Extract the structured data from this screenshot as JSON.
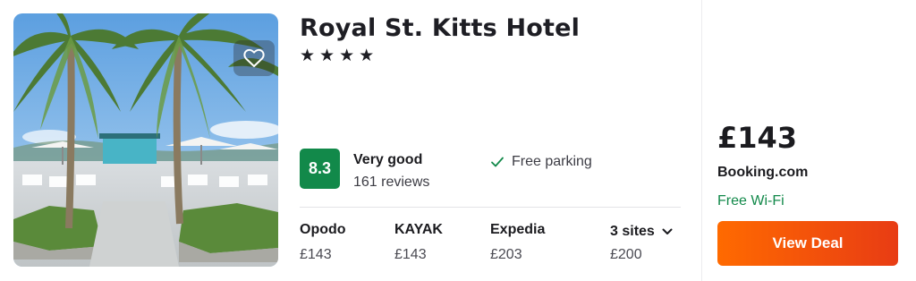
{
  "hotel": {
    "name": "Royal St. Kitts Hotel",
    "stars": [
      "★",
      "★",
      "★",
      "★"
    ],
    "rating": {
      "score": "8.3",
      "label": "Very good",
      "reviews": "161 reviews",
      "badge_color": "#12894a"
    },
    "amenity": {
      "icon": "check-icon",
      "text": "Free parking"
    }
  },
  "providers": [
    {
      "name": "Opodo",
      "price": "£143"
    },
    {
      "name": "KAYAK",
      "price": "£143"
    },
    {
      "name": "Expedia",
      "price": "£203"
    }
  ],
  "more_sites": {
    "label": "3 sites",
    "price": "£200",
    "icon": "chevron-down-icon"
  },
  "deal": {
    "price": "£143",
    "provider": "Booking.com",
    "amenity": "Free Wi-Fi",
    "button_label": "View Deal",
    "button_color": "#ff5a1f"
  },
  "favorite": {
    "icon": "heart-icon"
  },
  "photo": {
    "icon": "hotel-photo"
  }
}
